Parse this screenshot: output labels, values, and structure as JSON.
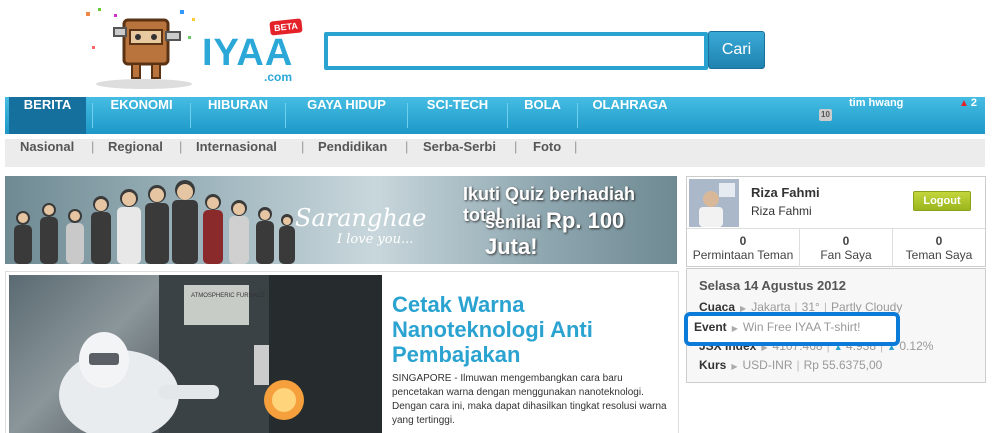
{
  "header": {
    "logo_text": "IYAA",
    "logo_com": ".com",
    "logo_beta": "BETA",
    "search_placeholder": "",
    "search_button": "Cari"
  },
  "nav": {
    "items": [
      "BERITA",
      "EKONOMI",
      "HIBURAN",
      "GAYA HIDUP",
      "SCI-TECH",
      "BOLA",
      "OLAHRAGA"
    ],
    "user_badge": "10",
    "user_name": "tim hwang",
    "notif_count": "2"
  },
  "subnav": {
    "items": [
      "Nasional",
      "Regional",
      "Internasional",
      "Pendidikan",
      "Serba-Serbi",
      "Foto"
    ]
  },
  "banner": {
    "script_title": "Saranghae",
    "script_sub": "I love you...",
    "line1": "Ikuti Quiz berhadiah total",
    "line2_prefix": "senilai ",
    "line2_amount": "Rp. 100 Juta!"
  },
  "feature": {
    "title": "Cetak Warna Nanoteknologi Anti Pembajakan",
    "body": "SINGAPORE - Ilmuwan mengembangkan cara baru pencetakan warna dengan menggunakan nanoteknologi. Dengan cara ini, maka dapat dihasilkan tingkat resolusi warna yang tertinggi.",
    "image_label": "ATMOSPHERIC FURNACE"
  },
  "profile": {
    "name": "Riza Fahmi",
    "sub": "Riza Fahmi",
    "logout": "Logout",
    "stats": [
      {
        "num": "0",
        "label": "Permintaan Teman"
      },
      {
        "num": "0",
        "label": "Fan Saya"
      },
      {
        "num": "0",
        "label": "Teman Saya"
      }
    ]
  },
  "info": {
    "date": "Selasa 14 Agustus 2012",
    "weather_label": "Cuaca",
    "weather_city": "Jakarta",
    "weather_temp": "31°",
    "weather_desc": "Partly Cloudy",
    "event_label": "Event",
    "event_text": "Win Free IYAA T-shirt!",
    "jsx_label": "JSX Index",
    "jsx_value": "4107.468",
    "jsx_change": "4.938",
    "jsx_pct": "0.12%",
    "kurs_label": "Kurs",
    "kurs_pair": "USD-INR",
    "kurs_value": "Rp 55.6375,00"
  },
  "colors": {
    "accent": "#2aa3d1",
    "nav_active": "#16709d",
    "logout": "#9bb51e",
    "highlight": "#0a7bd8"
  }
}
